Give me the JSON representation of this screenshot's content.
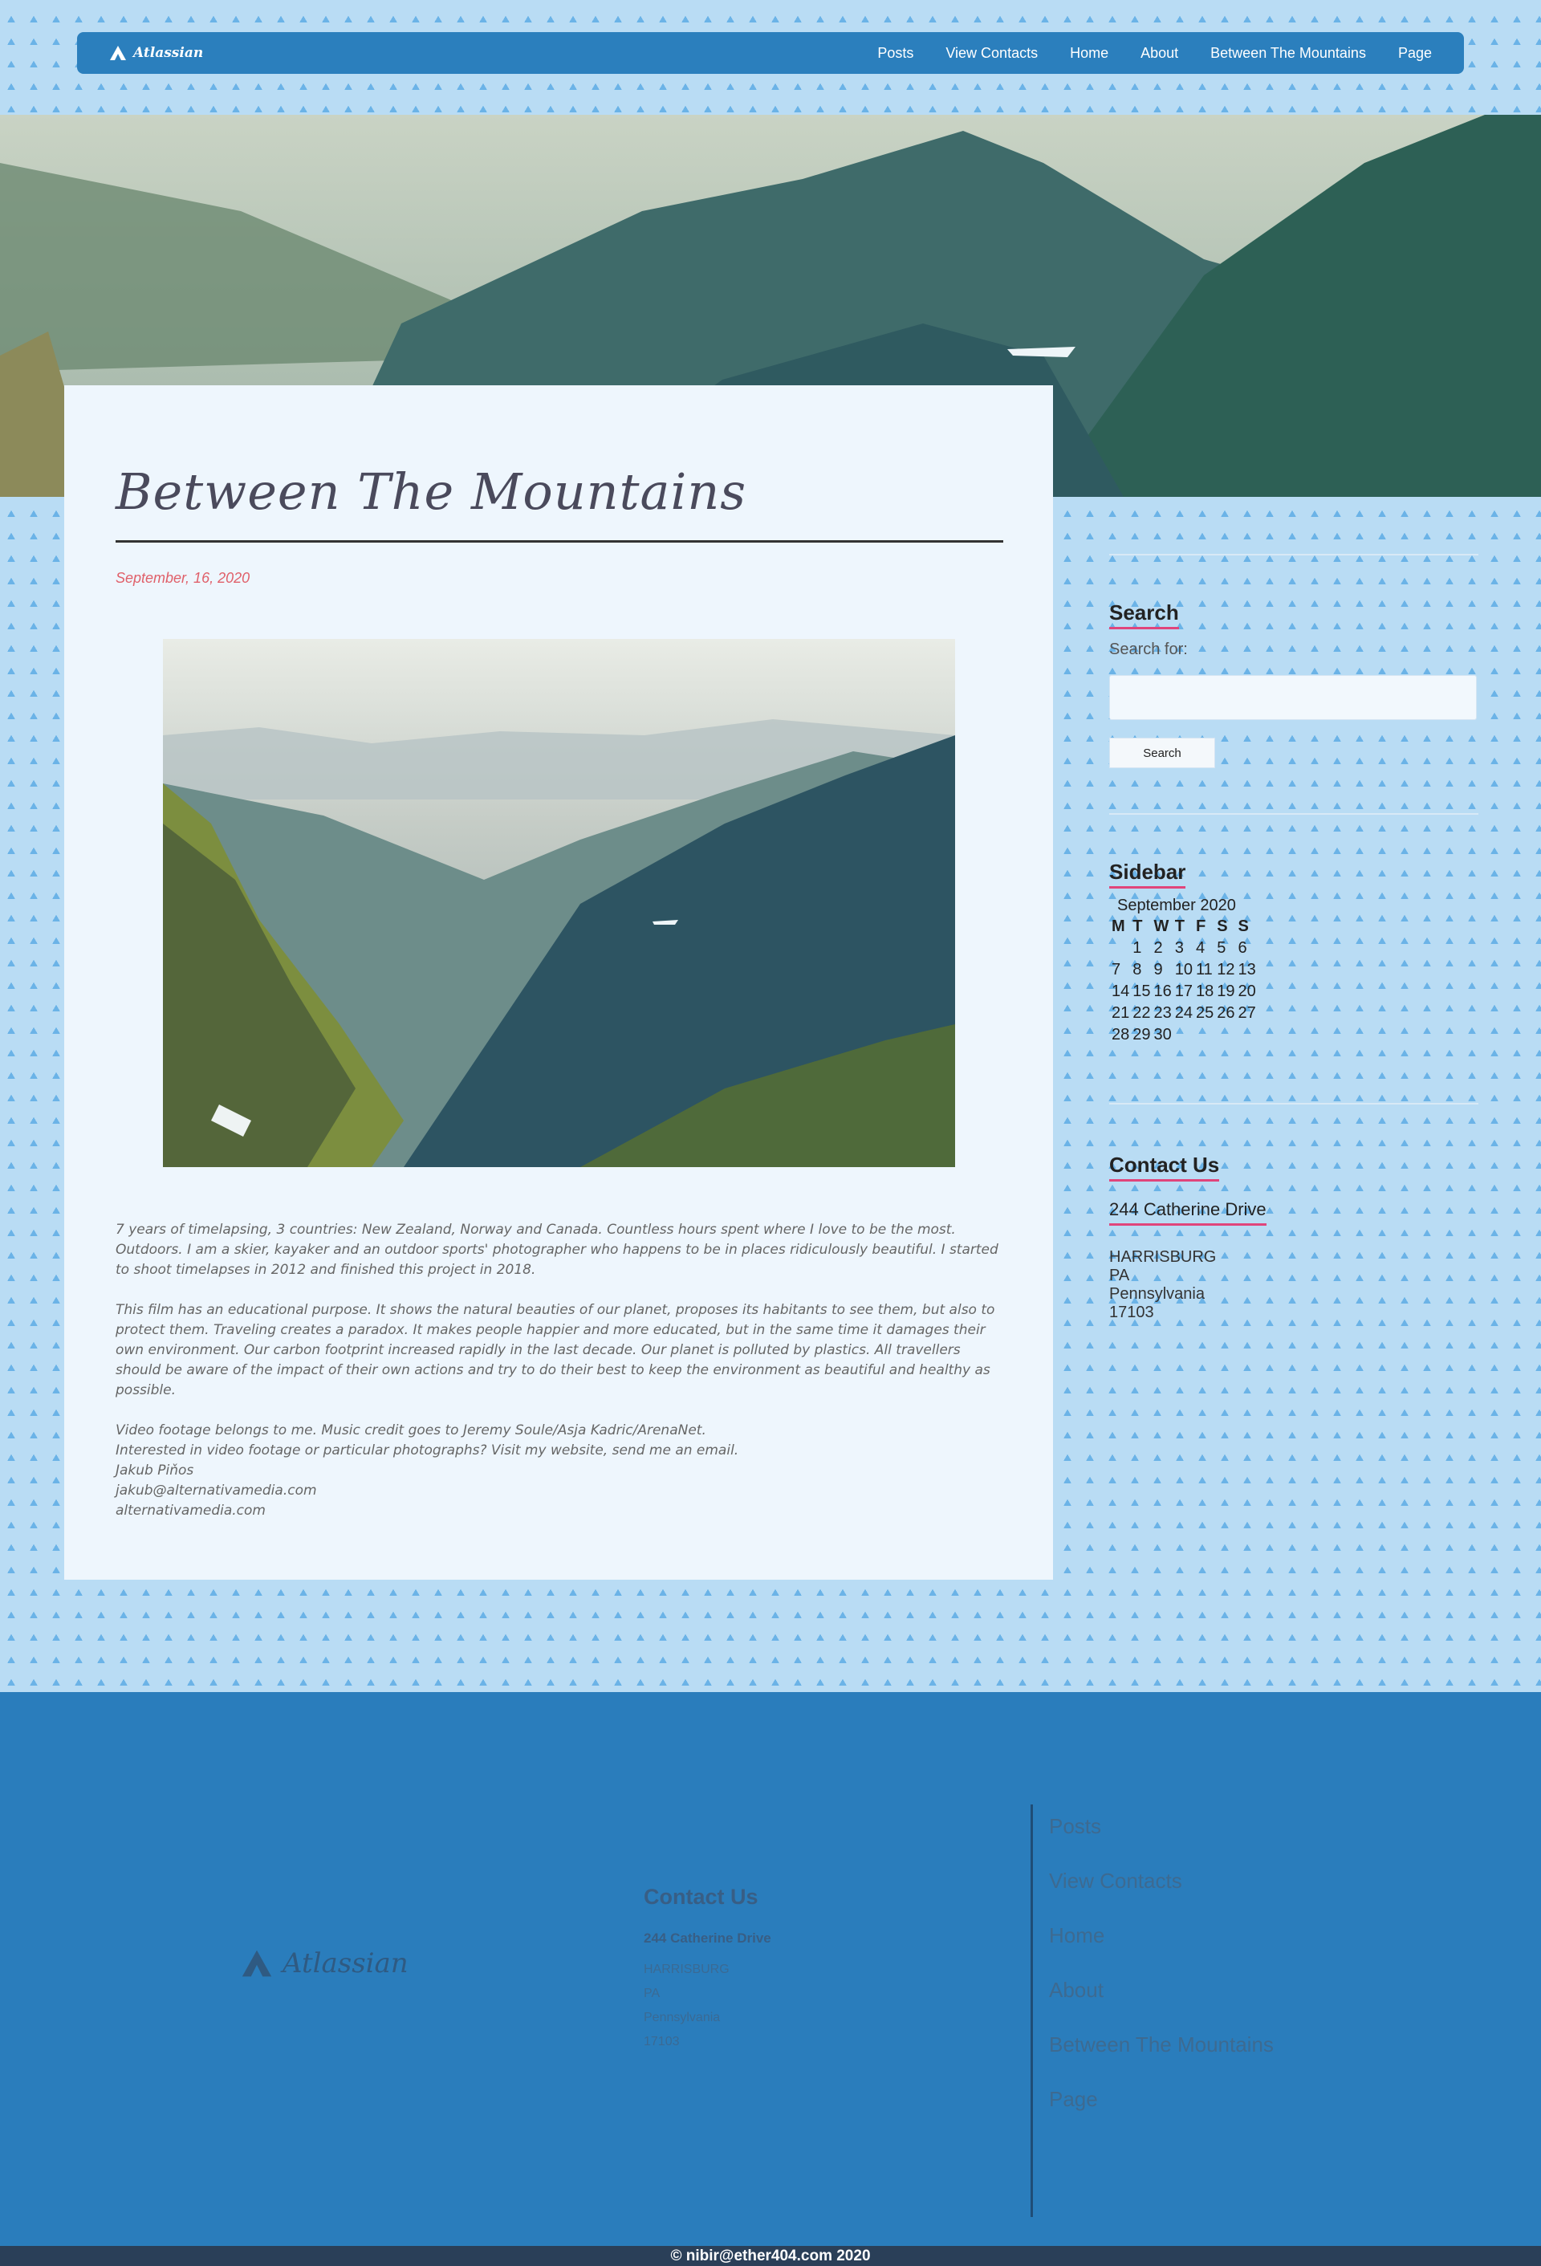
{
  "nav": {
    "brand": "Atlassian",
    "links": [
      "Posts",
      "View Contacts",
      "Home",
      "About",
      "Between The Mountains",
      "Page"
    ]
  },
  "post": {
    "title": "Between The Mountains",
    "date": "September, 16, 2020",
    "paragraph1": "7 years of timelapsing, 3 countries: New Zealand, Norway and Canada. Countless hours spent where I love to be the most. Outdoors. I am a skier, kayaker and an outdoor sports' photographer who happens to be in places ridiculously beautiful. I started to shoot timelapses in 2012 and finished this project in 2018.",
    "paragraph2": "This film has an educational purpose. It shows the natural beauties of our planet, proposes its habitants to see them, but also to protect them. Traveling creates a paradox. It makes people happier and more educated, but in the same time it damages their own environment. Our carbon footprint increased rapidly in the last decade. Our planet is polluted by plastics. All travellers should be aware of the impact of their own actions and try to do their best to keep the environment as beautiful and healthy as possible.",
    "credit_lines": [
      "Video footage belongs to me. Music credit goes to Jeremy Soule/Asja Kadric/ArenaNet.",
      "Interested in video footage or particular photographs? Visit my website, send me an email.",
      "Jakub Piňos",
      "jakub@alternativamedia.com",
      "alternativamedia.com"
    ]
  },
  "sidebar": {
    "search_title": "Search",
    "search_label": "Search for:",
    "search_button": "Search",
    "calendar_title": "Sidebar",
    "calendar_caption": "September 2020",
    "calendar_headers": [
      "M",
      "T",
      "W",
      "T",
      "F",
      "S",
      "S"
    ],
    "calendar_rows": [
      [
        "",
        "1",
        "2",
        "3",
        "4",
        "5",
        "6"
      ],
      [
        "7",
        "8",
        "9",
        "10",
        "11",
        "12",
        "13"
      ],
      [
        "14",
        "15",
        "16",
        "17",
        "18",
        "19",
        "20"
      ],
      [
        "21",
        "22",
        "23",
        "24",
        "25",
        "26",
        "27"
      ],
      [
        "28",
        "29",
        "30",
        "",
        "",
        "",
        ""
      ]
    ],
    "contact_title": "Contact Us",
    "contact_street": "244 Catherine Drive",
    "contact_lines": [
      "HARRISBURG",
      "PA",
      "Pennsylvania",
      "17103"
    ]
  },
  "footer": {
    "brand": "Atlassian",
    "contact_title": "Contact Us",
    "contact_street": "244 Catherine Drive",
    "contact_lines": [
      "HARRISBURG",
      "PA",
      "Pennsylvania",
      "17103"
    ],
    "nav_links": [
      "Posts",
      "View Contacts",
      "Home",
      "About",
      "Between The Mountains",
      "Page"
    ],
    "copyright": "© nibir@ether404.com 2020"
  },
  "colors": {
    "accent": "#2b7fbd",
    "underline": "#e0457b",
    "background": "#b9dcf4"
  }
}
